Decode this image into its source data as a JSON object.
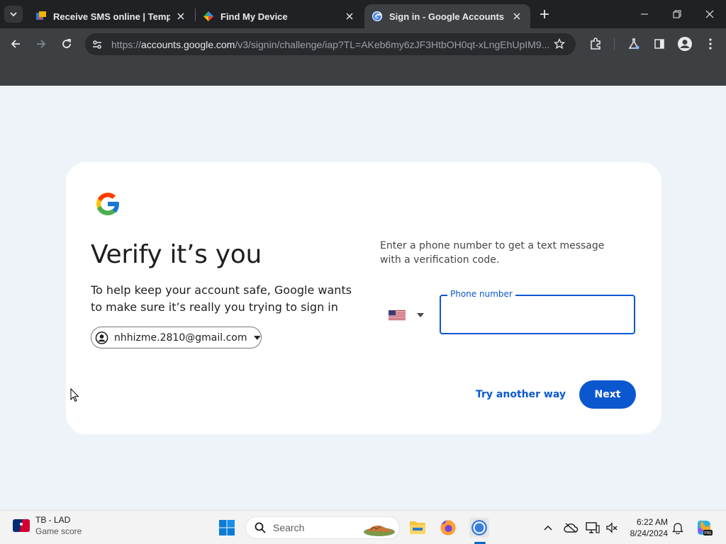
{
  "browser": {
    "tabs": [
      {
        "title": "Receive SMS online | Temporary",
        "icon": "sms-site-favicon",
        "active": false
      },
      {
        "title": "Find My Device",
        "icon": "find-my-device-favicon",
        "active": false
      },
      {
        "title": "Sign in - Google Accounts",
        "icon": "google-favicon",
        "active": true
      }
    ],
    "url_scheme": "https://",
    "url_host": "accounts.google.com",
    "url_path": "/v3/signin/challenge/iap?TL=AKeb6my6zJF3HtbOH0qt-xLngEhUpIM9..."
  },
  "page": {
    "heading": "Verify it’s you",
    "description": "To help keep your account safe, Google wants to make sure it’s really you trying to sign in",
    "account_email": "nhhizme.2810@gmail.com",
    "instructions": "Enter a phone number to get a text message with a verification code.",
    "country_flag": "us-flag-icon",
    "phone_label": "Phone number",
    "phone_value": "",
    "try_another_way": "Try another way",
    "next": "Next"
  },
  "taskbar": {
    "widget_title": "TB - LAD",
    "widget_subtitle": "Game score",
    "search_placeholder": "Search",
    "time": "6:22 AM",
    "date": "8/24/2024"
  },
  "colors": {
    "accent": "#0b57d0",
    "page_bg": "#eef3f9",
    "chrome_dark": "#202124",
    "chrome_toolbar": "#3c4043"
  }
}
